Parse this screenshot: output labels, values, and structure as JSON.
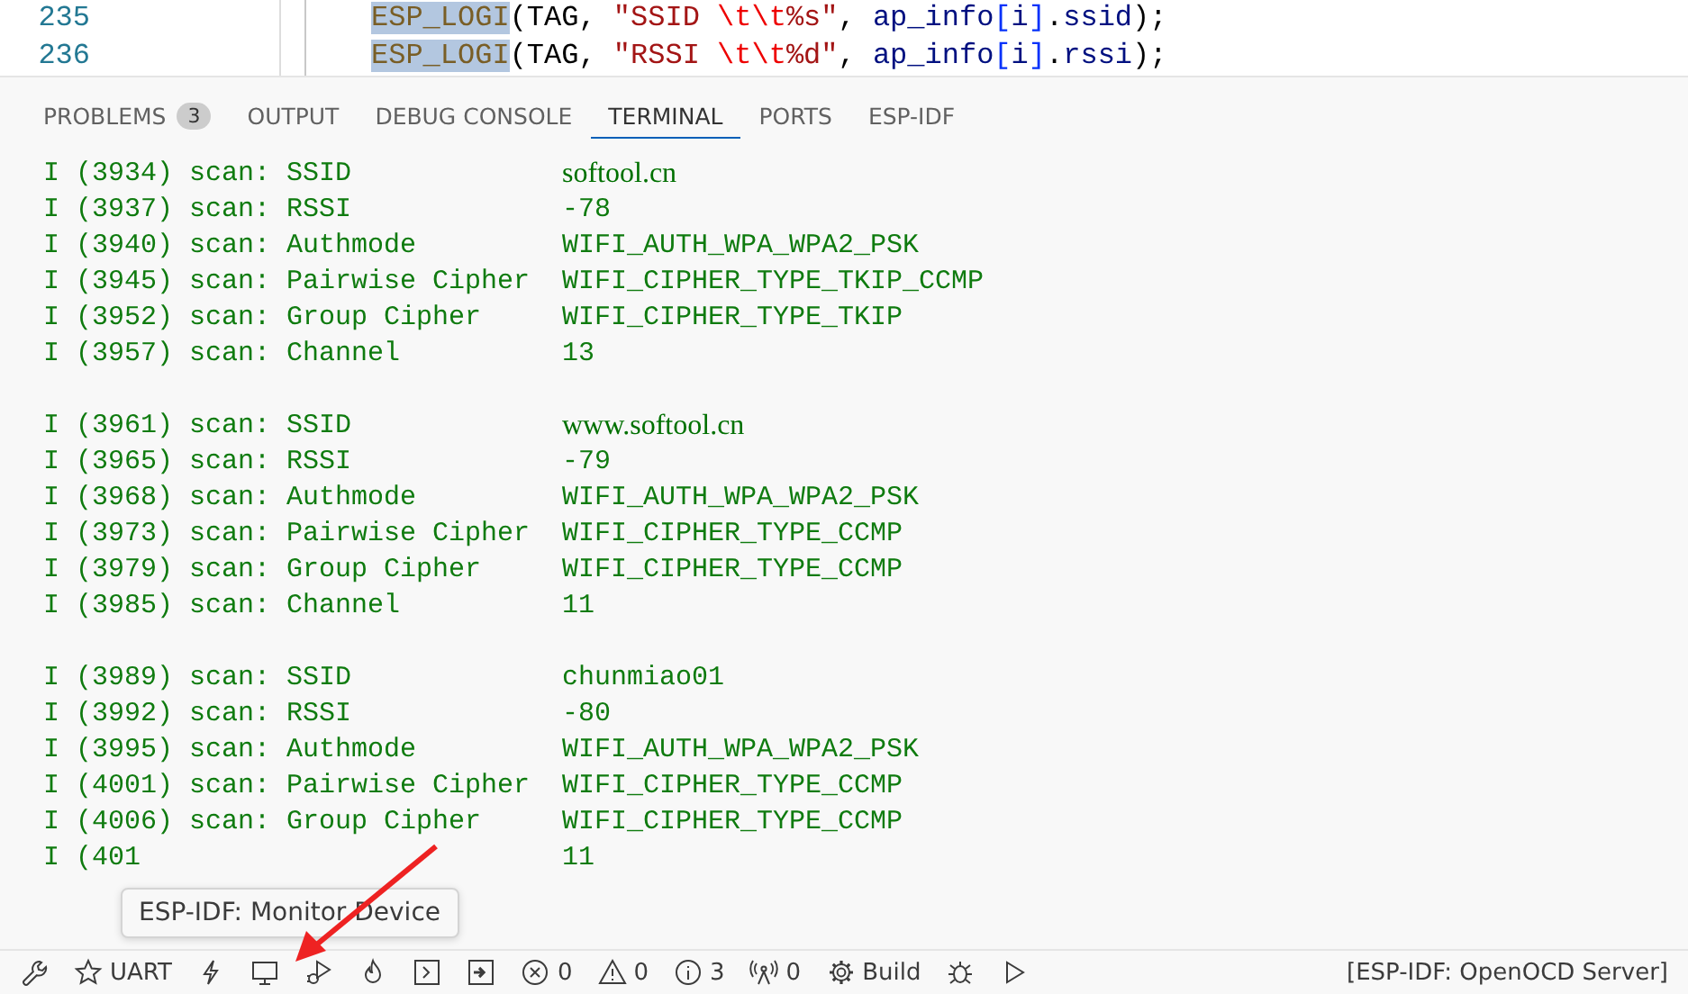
{
  "editor": {
    "lines": [
      {
        "number": "235",
        "tokens": [
          {
            "text": "ESP_LOGI",
            "kind": "fn-selected"
          },
          {
            "text": "(TAG, ",
            "kind": "plain"
          },
          {
            "text": "\"SSID ",
            "kind": "string"
          },
          {
            "text": "\\t\\t",
            "kind": "escape"
          },
          {
            "text": "%s\"",
            "kind": "string"
          },
          {
            "text": ", ",
            "kind": "plain"
          },
          {
            "text": "ap_info",
            "kind": "var"
          },
          {
            "text": "[",
            "kind": "bracket"
          },
          {
            "text": "i",
            "kind": "var"
          },
          {
            "text": "]",
            "kind": "bracket"
          },
          {
            "text": ".",
            "kind": "plain"
          },
          {
            "text": "ssid",
            "kind": "var"
          },
          {
            "text": ");",
            "kind": "plain"
          }
        ]
      },
      {
        "number": "236",
        "tokens": [
          {
            "text": "ESP_LOGI",
            "kind": "fn-selected"
          },
          {
            "text": "(TAG, ",
            "kind": "plain"
          },
          {
            "text": "\"RSSI ",
            "kind": "string"
          },
          {
            "text": "\\t\\t",
            "kind": "escape"
          },
          {
            "text": "%d\"",
            "kind": "string"
          },
          {
            "text": ", ",
            "kind": "plain"
          },
          {
            "text": "ap_info",
            "kind": "var"
          },
          {
            "text": "[",
            "kind": "bracket"
          },
          {
            "text": "i",
            "kind": "var"
          },
          {
            "text": "]",
            "kind": "bracket"
          },
          {
            "text": ".",
            "kind": "plain"
          },
          {
            "text": "rssi",
            "kind": "var"
          },
          {
            "text": ");",
            "kind": "plain"
          }
        ]
      }
    ]
  },
  "panel_tabs": [
    {
      "label": "PROBLEMS",
      "badge": "3",
      "selected": false
    },
    {
      "label": "OUTPUT",
      "selected": false
    },
    {
      "label": "DEBUG CONSOLE",
      "selected": false
    },
    {
      "label": "TERMINAL",
      "selected": true
    },
    {
      "label": "PORTS",
      "selected": false
    },
    {
      "label": "ESP-IDF",
      "selected": false
    }
  ],
  "terminal": {
    "lines": [
      {
        "kind": "ssid",
        "label": "I (3934) scan: SSID",
        "value": "softool.cn"
      },
      {
        "kind": "field",
        "label": "I (3937) scan: RSSI",
        "value": "-78"
      },
      {
        "kind": "field",
        "label": "I (3940) scan: Authmode",
        "value": "WIFI_AUTH_WPA_WPA2_PSK"
      },
      {
        "kind": "field",
        "label": "I (3945) scan: Pairwise Cipher",
        "value": "WIFI_CIPHER_TYPE_TKIP_CCMP"
      },
      {
        "kind": "field",
        "label": "I (3952) scan: Group Cipher",
        "value": "WIFI_CIPHER_TYPE_TKIP"
      },
      {
        "kind": "field",
        "label": "I (3957) scan: Channel",
        "value": "13"
      },
      {
        "kind": "blank"
      },
      {
        "kind": "ssid",
        "label": "I (3961) scan: SSID",
        "value": "www.softool.cn"
      },
      {
        "kind": "field",
        "label": "I (3965) scan: RSSI",
        "value": "-79"
      },
      {
        "kind": "field",
        "label": "I (3968) scan: Authmode",
        "value": "WIFI_AUTH_WPA_WPA2_PSK"
      },
      {
        "kind": "field",
        "label": "I (3973) scan: Pairwise Cipher",
        "value": "WIFI_CIPHER_TYPE_CCMP"
      },
      {
        "kind": "field",
        "label": "I (3979) scan: Group Cipher",
        "value": "WIFI_CIPHER_TYPE_CCMP"
      },
      {
        "kind": "field",
        "label": "I (3985) scan: Channel",
        "value": "11"
      },
      {
        "kind": "blank"
      },
      {
        "kind": "field",
        "label": "I (3989) scan: SSID",
        "value": "chunmiao01"
      },
      {
        "kind": "field",
        "label": "I (3992) scan: RSSI",
        "value": "-80"
      },
      {
        "kind": "field",
        "label": "I (3995) scan: Authmode",
        "value": "WIFI_AUTH_WPA_WPA2_PSK"
      },
      {
        "kind": "field",
        "label": "I (4001) scan: Pairwise Cipher",
        "value": "WIFI_CIPHER_TYPE_CCMP"
      },
      {
        "kind": "field",
        "label": "I (4006) scan: Group Cipher",
        "value": "WIFI_CIPHER_TYPE_CCMP"
      },
      {
        "kind": "field",
        "label": "I (401",
        "value": "11"
      }
    ]
  },
  "tooltip": {
    "text": "ESP-IDF: Monitor Device"
  },
  "status_bar": {
    "items": [
      {
        "kind": "wrench"
      },
      {
        "kind": "star",
        "label": "UART"
      },
      {
        "kind": "bolt"
      },
      {
        "kind": "monitor"
      },
      {
        "kind": "debug-play"
      },
      {
        "kind": "flame"
      },
      {
        "kind": "terminal"
      },
      {
        "kind": "enter"
      },
      {
        "kind": "error",
        "label": "0"
      },
      {
        "kind": "warning",
        "label": "0"
      },
      {
        "kind": "info",
        "label": "3"
      },
      {
        "kind": "antenna",
        "label": "0"
      },
      {
        "kind": "gear",
        "label": "Build"
      },
      {
        "kind": "bug"
      },
      {
        "kind": "play"
      }
    ],
    "right": "[ESP-IDF: OpenOCD Server]"
  }
}
